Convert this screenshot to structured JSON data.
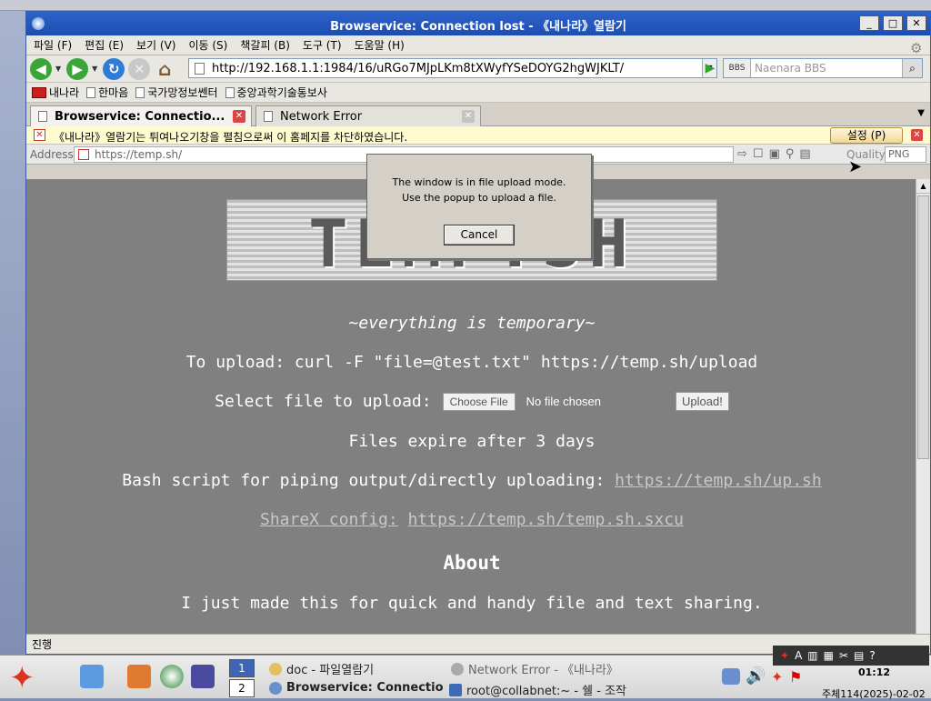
{
  "window": {
    "title": "Browservice: Connection lost - 《내나라》열람기"
  },
  "menu": [
    "파일 (F)",
    "편집 (E)",
    "보기 (V)",
    "이동 (S)",
    "책갈피 (B)",
    "도구 (T)",
    "도움말 (H)"
  ],
  "nav": {
    "url": "http://192.168.1.1:1984/16/uRGo7MJpLKm8tXWyfYSeDOYG2hgWJKLT/",
    "search_engine": "BBS",
    "search_placeholder": "Naenara BBS"
  },
  "bookmarks": [
    "내나라",
    "한마음",
    "국가망정보쎈터",
    "중앙과학기술통보사"
  ],
  "tabs": [
    {
      "label": "Browservice: Connectio...",
      "active": true
    },
    {
      "label": "Network Error",
      "active": false
    }
  ],
  "popup_bar": {
    "message": "《내나라》열람기는 튀여나오기창을 펼침으로써 이 홈페지를 차단하였습니다.",
    "settings_label": "설정 (P)"
  },
  "address_bar": {
    "label": "Address",
    "value": "https://temp.sh/",
    "quality_label": "Quality",
    "quality_value": "PNG"
  },
  "page": {
    "logo_text": "TEMP.SH",
    "tagline": "~everything is temporary~",
    "upload_cmd": "To upload: curl -F \"file=@test.txt\" https://temp.sh/upload",
    "select_label": "Select file to upload:",
    "choose_file": "Choose File",
    "no_file": "No file chosen",
    "upload_button": "Upload!",
    "expire": "Files expire after 3 days",
    "bash_label": "Bash script for piping output/directly uploading:",
    "bash_link": "https://temp.sh/up.sh",
    "sharex_label": "ShareX config:",
    "sharex_link": "https://temp.sh/temp.sh.sxcu",
    "about_heading": "About",
    "about_text": "I just made this for quick and handy file and text sharing."
  },
  "dialog": {
    "line1": "The window is in file upload mode.",
    "line2": "Use the popup to upload a file.",
    "cancel": "Cancel"
  },
  "status": "진행",
  "taskbar": {
    "desk1": "1",
    "desk2": "2",
    "tasks": [
      "doc - 파일열람기",
      "Network Error - 《내나라》",
      "Browservice: Connectio",
      "root@collabnet:~ - 쉘 - 조작"
    ],
    "clock": "01:12",
    "date": "주체114(2025)-02-02"
  }
}
